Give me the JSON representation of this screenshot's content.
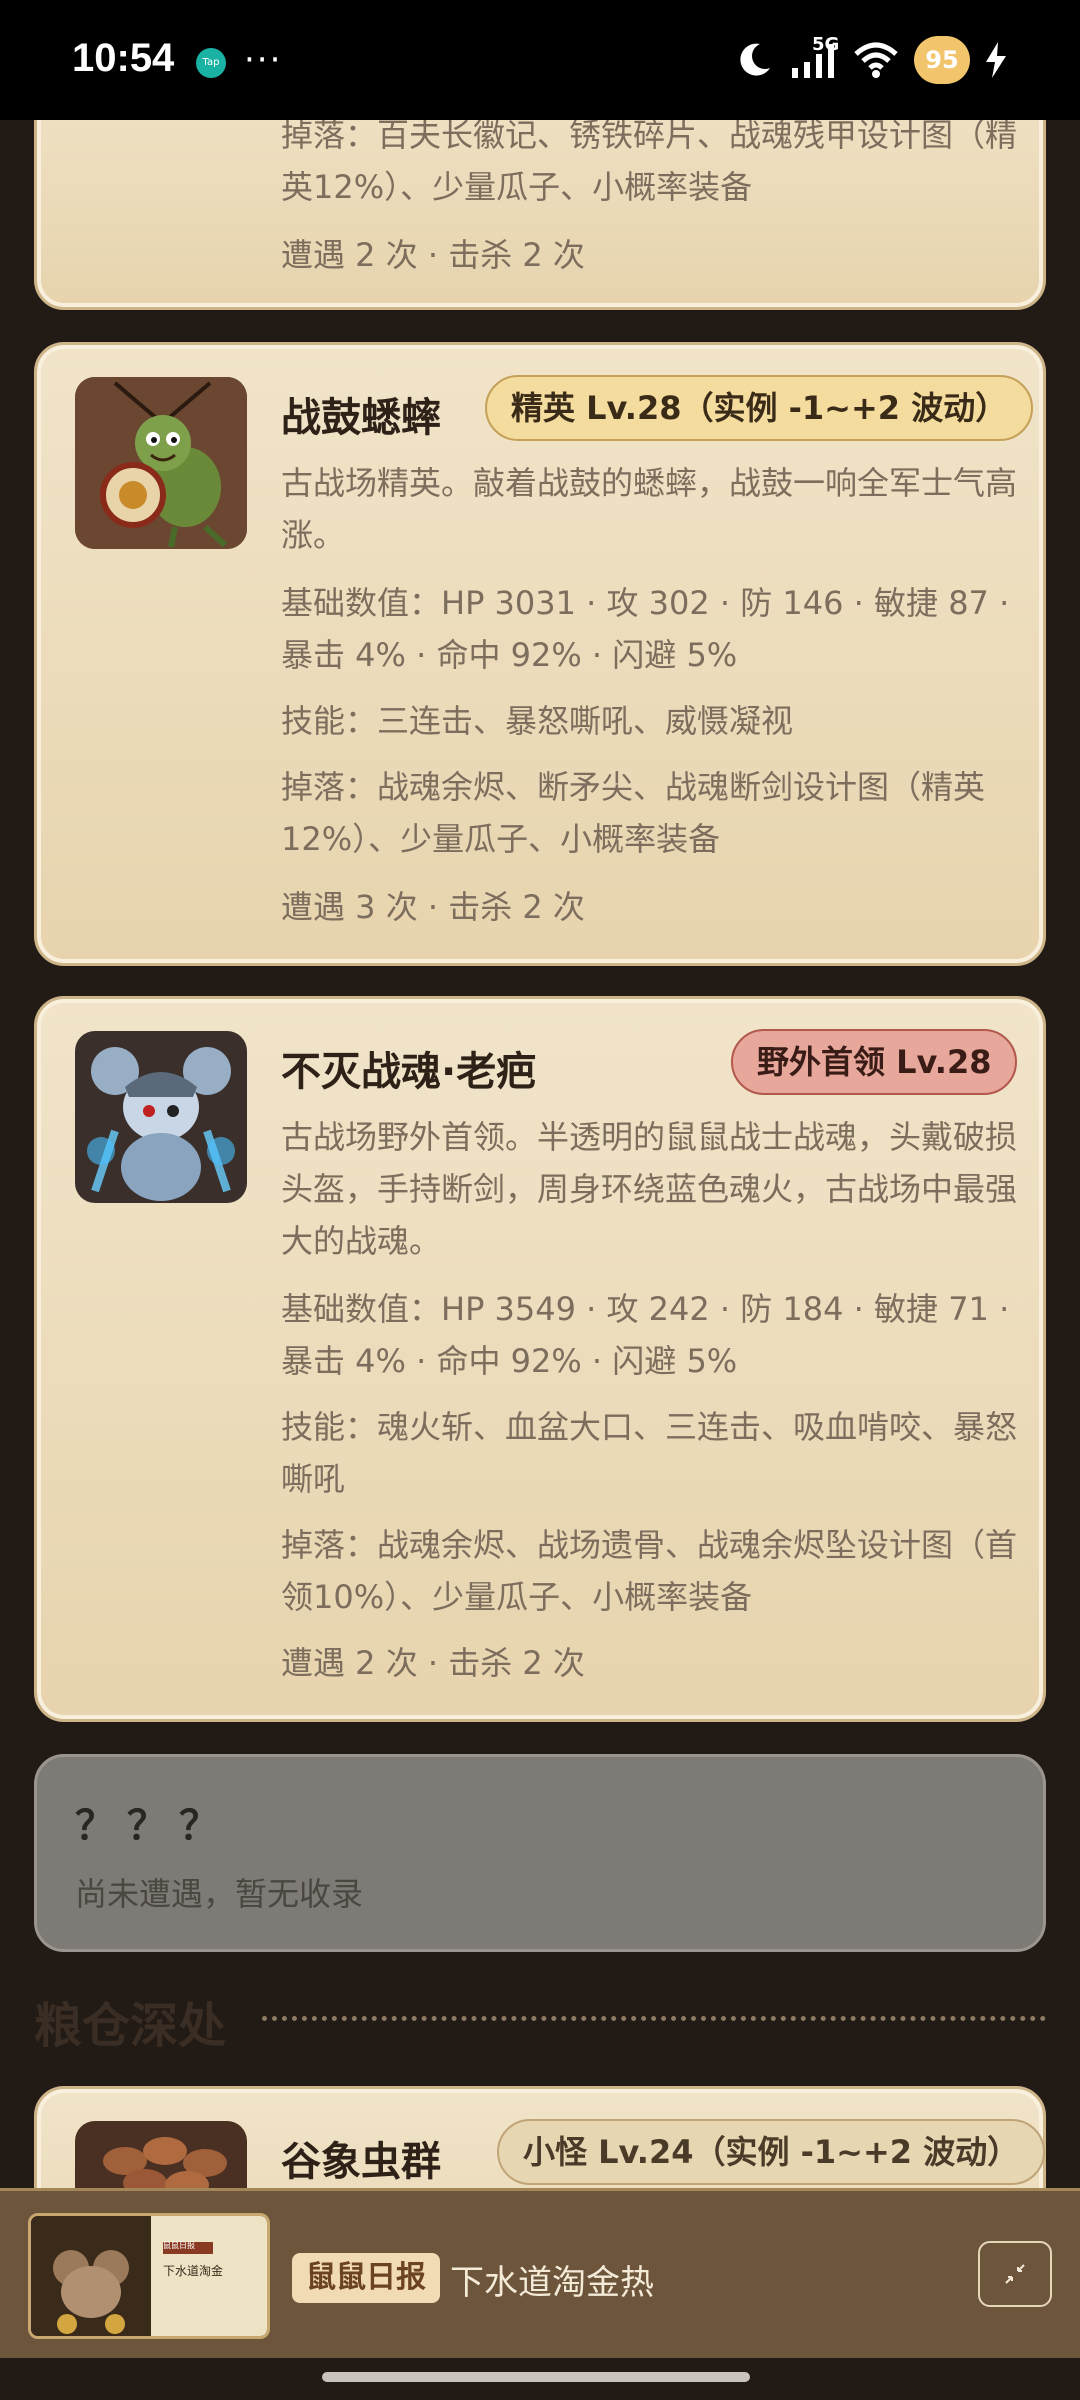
{
  "status_bar": {
    "time": "10:54",
    "app_icon": "Tap",
    "dots": "···",
    "network": "5G",
    "battery": "95"
  },
  "card0": {
    "drops": "掉落：百夫长徽记、锈铁碎片、战魂残甲设计图（精英12%）、少量瓜子、小概率装备",
    "encounters": "遭遇 2 次 · 击杀 2 次"
  },
  "card1": {
    "name": "战鼓蟋蟀",
    "tag": "精英 Lv.28（实例 -1~+2 波动）",
    "desc": "古战场精英。敲着战鼓的蟋蟀，战鼓一响全军士气高涨。",
    "stats": "基础数值：HP 3031 · 攻 302 · 防 146 · 敏捷 87 · 暴击 4% · 命中 92% · 闪避 5%",
    "skills": "技能：三连击、暴怒嘶吼、威慑凝视",
    "drops": "掉落：战魂余烬、断矛尖、战魂断剑设计图（精英12%）、少量瓜子、小概率装备",
    "encounters": "遭遇 3 次 · 击杀 2 次"
  },
  "card2": {
    "name": "不灭战魂·老疤",
    "tag": "野外首领 Lv.28",
    "desc": "古战场野外首领。半透明的鼠鼠战士战魂，头戴破损头盔，手持断剑，周身环绕蓝色魂火，古战场中最强大的战魂。",
    "stats": "基础数值：HP 3549 · 攻 242 · 防 184 · 敏捷 71 · 暴击 4% · 命中 92% · 闪避 5%",
    "skills": "技能：魂火斩、血盆大口、三连击、吸血啃咬、暴怒嘶吼",
    "drops": "掉落：战魂余烬、战场遗骨、战魂余烬坠设计图（首领10%）、少量瓜子、小概率装备",
    "encounters": "遭遇 2 次 · 击杀 2 次"
  },
  "unknown_card": {
    "title": "？？？",
    "subtitle": "尚未遭遇，暂无收录"
  },
  "section": {
    "title": "粮仓深处"
  },
  "card3": {
    "name": "谷象虫群",
    "tag": "小怪 Lv.24（实例 -1~+2 波动）"
  },
  "bottom_bar": {
    "badge": "鼠鼠日报",
    "title": "下水道淘金热",
    "thumb_label": "鼠鼠日报",
    "thumb_title": "下水道淘金"
  },
  "colors": {
    "card_bg": "#f1e4c9",
    "elite_tag": "#f3dc9e",
    "boss_tag": "#e8a79b",
    "page_bg": "#221a15"
  }
}
